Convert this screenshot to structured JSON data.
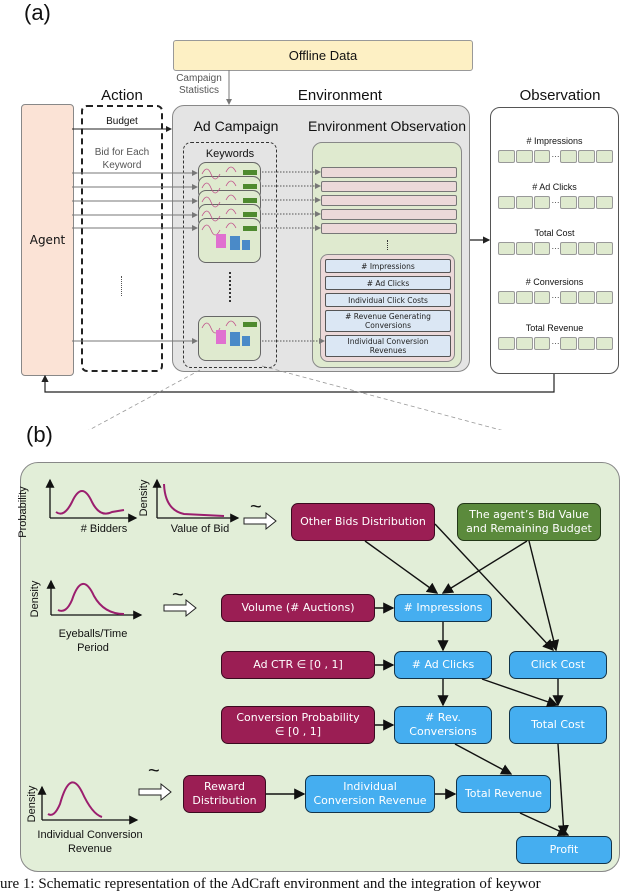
{
  "panel_a": {
    "label": "(a)",
    "offline_data": "Offline Data",
    "campaign_statistics": [
      "Campaign",
      "Statistics"
    ],
    "action_title": "Action",
    "environment_title": "Environment",
    "observation_title": "Observation",
    "agent_label": "Agent",
    "budget_label": "Budget",
    "bid_label": [
      "Bid for Each",
      "Keyword"
    ],
    "ad_campaign_title": "Ad Campaign",
    "keywords_title": "Keywords",
    "env_observation_title": "Environment Observation",
    "env_observation_items": [
      "# Impressions",
      "# Ad Clicks",
      "Individual Click Costs",
      "# Revenue Generating Conversions",
      "Individual Conversion Revenues"
    ],
    "observation_items": [
      "# Impressions",
      "# Ad Clicks",
      "Total Cost",
      "# Conversions",
      "Total Revenue"
    ],
    "ellipsis": "···"
  },
  "panel_b": {
    "label": "(b)",
    "distributions": [
      {
        "ylabel": "Probability",
        "xlabel": "# Bidders"
      },
      {
        "ylabel": "Density",
        "xlabel": "Value of Bid"
      },
      {
        "ylabel": "Density",
        "xlabel": "Eyeballs/Time Period"
      },
      {
        "ylabel": "Density",
        "xlabel": "Individual Conversion Revenue"
      }
    ],
    "tilde": "~",
    "nodes": {
      "other_bids": "Other Bids Distribution",
      "agent_bid": "The agent’s Bid Value and Remaining Budget",
      "volume": "Volume (# Auctions)",
      "impressions": "# Impressions",
      "ad_ctr": "Ad CTR ∈ [0 , 1]",
      "ad_clicks": "# Ad Clicks",
      "click_cost": "Click Cost",
      "conv_prob": "Conversion Probability ∈ [0 , 1]",
      "rev_conversions": "# Rev. Conversions",
      "total_cost": "Total Cost",
      "reward_dist": "Reward Distribution",
      "indiv_conv_rev": "Individual Conversion Revenue",
      "total_revenue": "Total Revenue",
      "profit": "Profit"
    },
    "colors": {
      "input_node": "#9b1e54",
      "computed_node": "#45aef0",
      "agent_node": "#5b8a3c",
      "background": "#e2eed8",
      "curve": "#9b1e6e"
    }
  },
  "caption": "ure 1: Schematic representation of the AdCraft environment and the integration of keywor"
}
